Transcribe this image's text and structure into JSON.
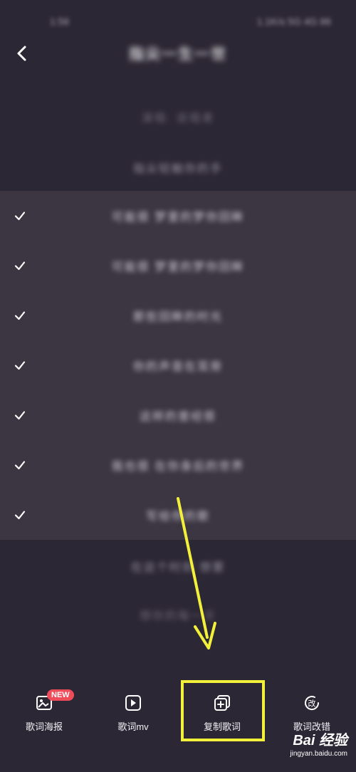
{
  "status": {
    "time": "1:56",
    "indicators": "1.1K/s 5G 4G 86"
  },
  "header": {
    "title": "指尖一生一世"
  },
  "lyrics_above": [
    "演唱: 说唱者",
    "指尖轻触你的手"
  ],
  "lyrics_selected": [
    "可能很 梦里的梦你回眸",
    "可能很 梦里的梦你回眸",
    "那些回眸的时光",
    "你的声音在耳旁",
    "这样的曾经很",
    "我也很 在你身后的世界",
    "写给你的歌"
  ],
  "lyrics_below": [
    "在这个时刻 想要",
    "想你的每一天"
  ],
  "toolbar": {
    "items": [
      {
        "label": "歌词海报",
        "icon": "poster-icon",
        "badge": "NEW"
      },
      {
        "label": "歌词mv",
        "icon": "play-video-icon"
      },
      {
        "label": "复制歌词",
        "icon": "copy-icon"
      },
      {
        "label": "歌词改错",
        "icon": "correct-icon"
      }
    ]
  },
  "annotation": {
    "color": "#f2f03a"
  },
  "watermark": {
    "brand": "Bai 经验",
    "domain": "jingyan.baidu.com"
  }
}
